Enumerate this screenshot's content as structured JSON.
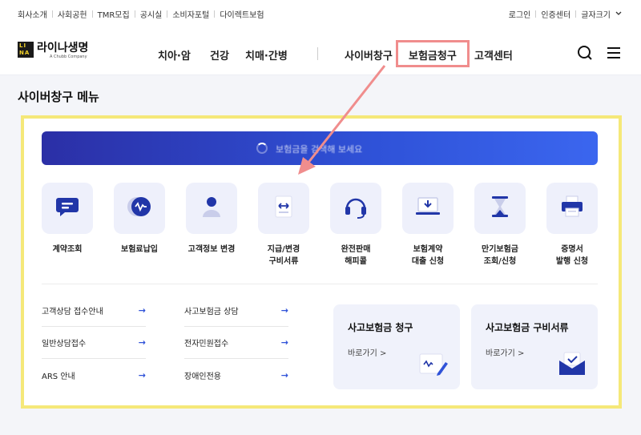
{
  "utility": {
    "left_links": [
      "회사소개",
      "사회공헌",
      "TMR모집",
      "공시실",
      "소비자포털",
      "다이렉트보험"
    ],
    "right_links": [
      "로그인",
      "인증센터",
      "글자크기"
    ]
  },
  "logo": {
    "box_text": "LI NA",
    "name": "라이나생명",
    "sub": "A Chubb Company"
  },
  "gnb": {
    "items": [
      "치아·암",
      "건강",
      "치매·간병",
      "사이버창구",
      "보험금청구",
      "고객센터"
    ]
  },
  "header_icons": [
    "search-icon",
    "menu-icon"
  ],
  "page_title": "사이버창구 메뉴",
  "search": {
    "placeholder": "보험금을 검색해 보세요"
  },
  "menu": [
    {
      "label": "계약조회",
      "icon": "chat-icon"
    },
    {
      "label": "보험료납입",
      "icon": "payment-icon"
    },
    {
      "label": "고객정보 변경",
      "icon": "user-icon"
    },
    {
      "label": "지급/변경\n구비서류",
      "icon": "document-swap-icon"
    },
    {
      "label": "완전판매\n해피콜",
      "icon": "headset-icon"
    },
    {
      "label": "보험계약\n대출 신청",
      "icon": "download-laptop-icon"
    },
    {
      "label": "만기보험금\n조회/신청",
      "icon": "hourglass-icon"
    },
    {
      "label": "증명서\n발행 신청",
      "icon": "printer-icon"
    }
  ],
  "links_left": [
    "고객상담 접수안내",
    "일반상담접수",
    "ARS 안내"
  ],
  "links_right": [
    "사고보험금 상담",
    "전자민원접수",
    "장애인전용"
  ],
  "cards": [
    {
      "title": "사고보험금 청구",
      "go": "바로가기 >"
    },
    {
      "title": "사고보험금 구비서류",
      "go": "바로가기 >"
    }
  ],
  "colors": {
    "accent": "#2f52d8",
    "highlight": "#f08d8d",
    "panel_border": "#f5e879"
  }
}
